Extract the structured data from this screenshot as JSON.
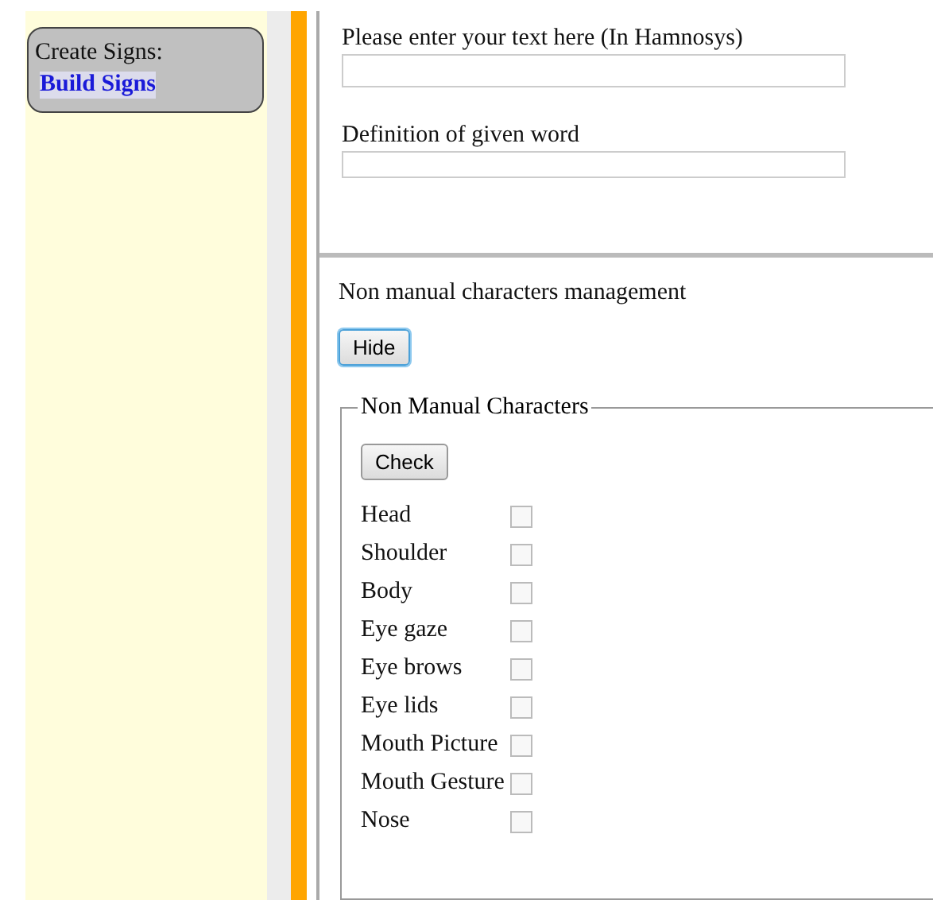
{
  "sidebar": {
    "title": "Create Signs:",
    "link": "Build Signs",
    "link_selected": true
  },
  "form": {
    "fields": [
      {
        "label": "Please enter your text here (In Hamnosys)"
      },
      {
        "label": "Definition of given word"
      }
    ]
  },
  "non_manual": {
    "heading": "Non manual characters management",
    "toggle_button": "Hide",
    "legend": "Non Manual Characters",
    "check_button": "Check",
    "items": [
      {
        "label": "Head",
        "checked": false
      },
      {
        "label": "Shoulder",
        "checked": false
      },
      {
        "label": "Body",
        "checked": false
      },
      {
        "label": "Eye gaze",
        "checked": false
      },
      {
        "label": "Eye brows",
        "checked": false
      },
      {
        "label": "Eye lids",
        "checked": false
      },
      {
        "label": "Mouth Picture",
        "checked": false
      },
      {
        "label": "Mouth Gesture",
        "checked": false
      },
      {
        "label": "Nose",
        "checked": false
      }
    ]
  }
}
